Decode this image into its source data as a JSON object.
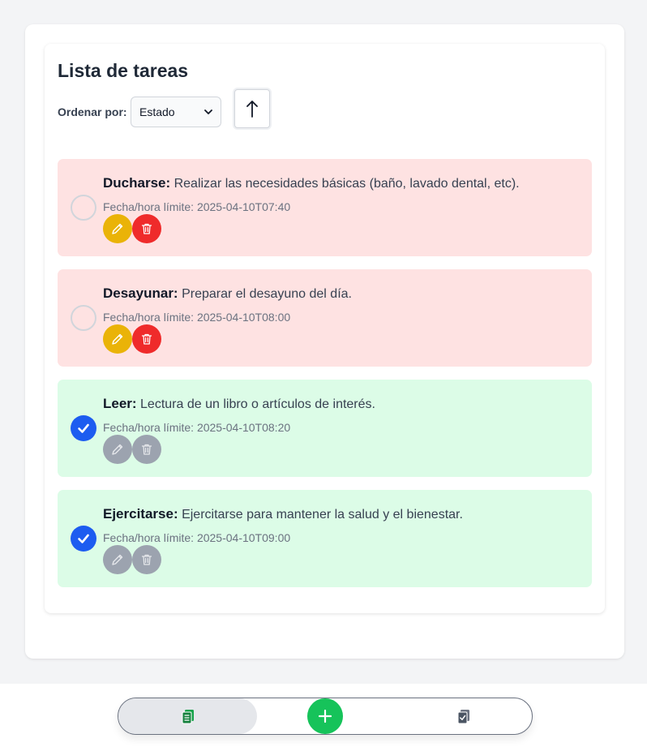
{
  "page": {
    "title": "Lista de tareas"
  },
  "sort": {
    "label": "Ordenar por:",
    "selected": "Estado",
    "direction_icon": "arrow-up-icon"
  },
  "tasks": [
    {
      "name": "Ducharse:",
      "description": "Realizar las necesidades básicas (baño, lavado dental, etc).",
      "due_label": "Fecha/hora límite: 2025-04-10T07:40",
      "completed": false
    },
    {
      "name": "Desayunar:",
      "description": "Preparar el desayuno del día.",
      "due_label": "Fecha/hora límite: 2025-04-10T08:00",
      "completed": false
    },
    {
      "name": "Leer:",
      "description": "Lectura de un libro o artículos de interés.",
      "due_label": "Fecha/hora límite: 2025-04-10T08:20",
      "completed": true
    },
    {
      "name": "Ejercitarse:",
      "description": "Ejercitarse para mantener la salud y el bienestar.",
      "due_label": "Fecha/hora límite: 2025-04-10T09:00",
      "completed": true
    }
  ],
  "bottom_nav": {
    "left_icon": "task-list-icon",
    "center_icon": "plus-icon",
    "right_icon": "completed-tasks-icon"
  },
  "colors": {
    "pending_bg": "#fee2e2",
    "done_bg": "#dcfce7",
    "check_blue": "#1d5cf0",
    "edit_yellow": "#eab308",
    "delete_red": "#ef2b2b",
    "add_green": "#16c35a",
    "disabled_gray": "#9ca3af"
  }
}
